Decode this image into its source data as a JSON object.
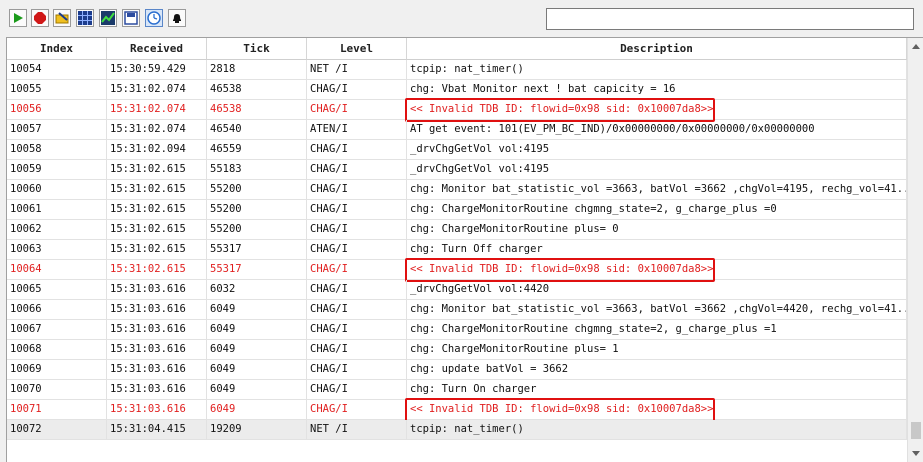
{
  "toolbar": {
    "buttons": [
      {
        "icon": "play-icon",
        "color": "#1a9a1a"
      },
      {
        "icon": "stop-icon",
        "color": "#d01818"
      },
      {
        "icon": "filter-icon",
        "color": "#e0a800"
      },
      {
        "icon": "table-icon",
        "color": "#1c3c8c"
      },
      {
        "icon": "chart-icon",
        "color": "#1a7a3a"
      },
      {
        "icon": "save-icon",
        "color": "#2c4ca0"
      },
      {
        "icon": "clock-icon",
        "color": "#2b6fd0"
      },
      {
        "icon": "bell-icon",
        "color": "#111111"
      }
    ],
    "search": {
      "value": "",
      "placeholder": ""
    }
  },
  "columns": [
    "Index",
    "Received",
    "Tick",
    "Level",
    "Description"
  ],
  "rows": [
    {
      "index": "10054",
      "received": "15:30:59.429",
      "tick": "2818",
      "level": "NET /I",
      "description": "tcpip: nat_timer()"
    },
    {
      "index": "10055",
      "received": "15:31:02.074",
      "tick": "46538",
      "level": "CHAG/I",
      "description": "chg: Vbat Monitor next ! bat capicity = 16"
    },
    {
      "index": "10056",
      "received": "15:31:02.074",
      "tick": "46538",
      "level": "CHAG/I",
      "description": "<< Invalid TDB ID: flowid=0x98 sid: 0x10007da8>>",
      "error": true,
      "highlight": true
    },
    {
      "index": "10057",
      "received": "15:31:02.074",
      "tick": "46540",
      "level": "ATEN/I",
      "description": "AT get event: 101(EV_PM_BC_IND)/0x00000000/0x00000000/0x00000000"
    },
    {
      "index": "10058",
      "received": "15:31:02.094",
      "tick": "46559",
      "level": "CHAG/I",
      "description": "_drvChgGetVol vol:4195"
    },
    {
      "index": "10059",
      "received": "15:31:02.615",
      "tick": "55183",
      "level": "CHAG/I",
      "description": "_drvChgGetVol vol:4195"
    },
    {
      "index": "10060",
      "received": "15:31:02.615",
      "tick": "55200",
      "level": "CHAG/I",
      "description": "chg:  Monitor  bat_statistic_vol =3663,  batVol =3662 ,chgVol=4195, rechg_vol=41..."
    },
    {
      "index": "10061",
      "received": "15:31:02.615",
      "tick": "55200",
      "level": "CHAG/I",
      "description": "chg: ChargeMonitorRoutine chgmng_state=2, g_charge_plus =0"
    },
    {
      "index": "10062",
      "received": "15:31:02.615",
      "tick": "55200",
      "level": "CHAG/I",
      "description": "chg: ChargeMonitorRoutine plus= 0"
    },
    {
      "index": "10063",
      "received": "15:31:02.615",
      "tick": "55317",
      "level": "CHAG/I",
      "description": "chg: Turn Off charger"
    },
    {
      "index": "10064",
      "received": "15:31:02.615",
      "tick": "55317",
      "level": "CHAG/I",
      "description": "<< Invalid TDB ID: flowid=0x98 sid: 0x10007da8>>",
      "error": true,
      "highlight": true
    },
    {
      "index": "10065",
      "received": "15:31:03.616",
      "tick": "6032",
      "level": "CHAG/I",
      "description": "_drvChgGetVol vol:4420"
    },
    {
      "index": "10066",
      "received": "15:31:03.616",
      "tick": "6049",
      "level": "CHAG/I",
      "description": "chg:  Monitor  bat_statistic_vol =3663,  batVol =3662 ,chgVol=4420, rechg_vol=41..."
    },
    {
      "index": "10067",
      "received": "15:31:03.616",
      "tick": "6049",
      "level": "CHAG/I",
      "description": "chg: ChargeMonitorRoutine chgmng_state=2, g_charge_plus =1"
    },
    {
      "index": "10068",
      "received": "15:31:03.616",
      "tick": "6049",
      "level": "CHAG/I",
      "description": "chg: ChargeMonitorRoutine plus= 1"
    },
    {
      "index": "10069",
      "received": "15:31:03.616",
      "tick": "6049",
      "level": "CHAG/I",
      "description": "chg: update batVol = 3662"
    },
    {
      "index": "10070",
      "received": "15:31:03.616",
      "tick": "6049",
      "level": "CHAG/I",
      "description": "chg: Turn On charger"
    },
    {
      "index": "10071",
      "received": "15:31:03.616",
      "tick": "6049",
      "level": "CHAG/I",
      "description": "<< Invalid TDB ID: flowid=0x98 sid: 0x10007da8>>",
      "error": true,
      "highlight": true
    },
    {
      "index": "10072",
      "received": "15:31:04.415",
      "tick": "19209",
      "level": "NET /I",
      "description": "tcpip: nat_timer()",
      "selected": true
    }
  ],
  "colors": {
    "error": "#e02020",
    "highlight_border": "#e01010",
    "selected_row": "#ececec"
  }
}
